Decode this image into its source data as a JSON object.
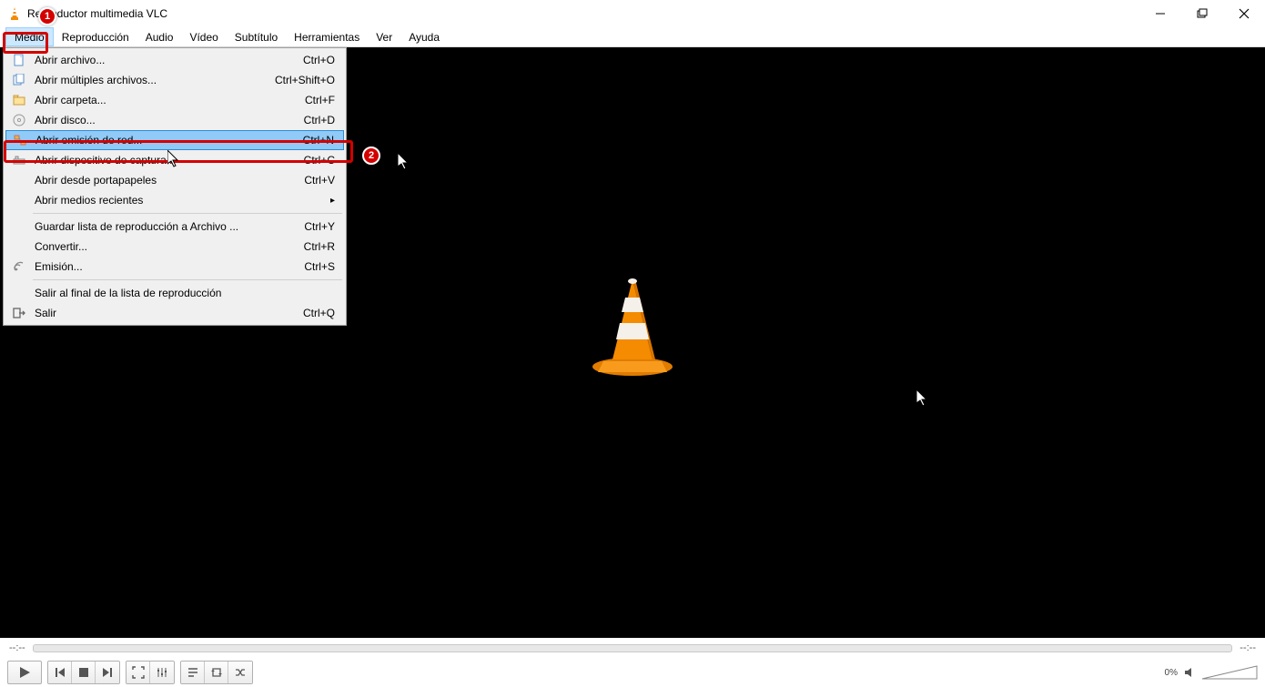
{
  "window": {
    "title": "Reproductor multimedia VLC"
  },
  "menubar": {
    "items": [
      "Medio",
      "Reproducción",
      "Audio",
      "Vídeo",
      "Subtítulo",
      "Herramientas",
      "Ver",
      "Ayuda"
    ],
    "active_index": 0
  },
  "dropdown": {
    "items": [
      {
        "label": "Abrir archivo...",
        "shortcut": "Ctrl+O",
        "icon": "file-icon"
      },
      {
        "label": "Abrir múltiples archivos...",
        "shortcut": "Ctrl+Shift+O",
        "icon": "files-icon"
      },
      {
        "label": "Abrir carpeta...",
        "shortcut": "Ctrl+F",
        "icon": "folder-icon"
      },
      {
        "label": "Abrir disco...",
        "shortcut": "Ctrl+D",
        "icon": "disc-icon"
      },
      {
        "label": "Abrir emisión de red...",
        "shortcut": "Ctrl+N",
        "icon": "network-icon",
        "highlighted": true
      },
      {
        "label": "Abrir dispositivo de captura...",
        "shortcut": "Ctrl+C",
        "icon": "capture-icon"
      },
      {
        "label": "Abrir desde portapapeles",
        "shortcut": "Ctrl+V",
        "icon": ""
      },
      {
        "label": "Abrir medios recientes",
        "shortcut": "",
        "icon": "",
        "submenu": true
      },
      {
        "sep": true
      },
      {
        "label": "Guardar lista de reproducción a Archivo ...",
        "shortcut": "Ctrl+Y",
        "icon": ""
      },
      {
        "label": "Convertir...",
        "shortcut": "Ctrl+R",
        "icon": ""
      },
      {
        "label": "Emisión...",
        "shortcut": "Ctrl+S",
        "icon": "stream-icon"
      },
      {
        "sep": true
      },
      {
        "label": "Salir al final de la lista de reproducción",
        "shortcut": "",
        "icon": ""
      },
      {
        "label": "Salir",
        "shortcut": "Ctrl+Q",
        "icon": "quit-icon"
      }
    ]
  },
  "player": {
    "time_elapsed": "--:--",
    "time_total": "--:--",
    "volume_percent": "0%"
  },
  "callouts": {
    "one": "1",
    "two": "2"
  }
}
